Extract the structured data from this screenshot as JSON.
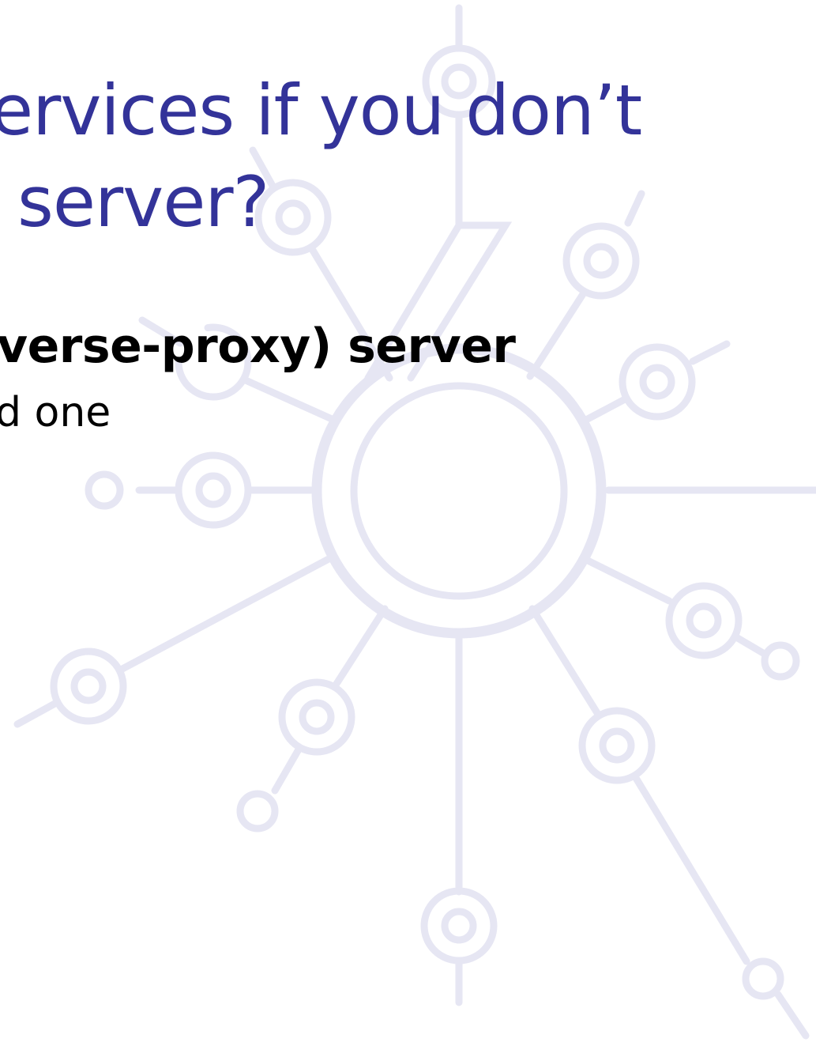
{
  "slide": {
    "title_line_1": "ervices if you don’t",
    "title_line_2": "server?",
    "bullet_1": "verse-proxy) server",
    "bullet_2": "d one",
    "accent_color": "#333399",
    "decoration_color": "#e8e8f4",
    "background_icon": "network-hub-icon"
  }
}
